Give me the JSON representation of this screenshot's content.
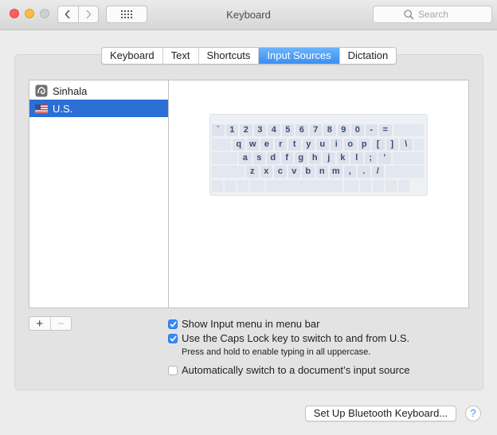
{
  "window": {
    "title": "Keyboard",
    "search_placeholder": "Search"
  },
  "tabs": [
    {
      "label": "Keyboard",
      "active": false
    },
    {
      "label": "Text",
      "active": false
    },
    {
      "label": "Shortcuts",
      "active": false
    },
    {
      "label": "Input Sources",
      "active": true
    },
    {
      "label": "Dictation",
      "active": false
    }
  ],
  "sources": [
    {
      "label": "Sinhala",
      "icon": "sinhala-script-icon",
      "selected": false
    },
    {
      "label": "U.S.",
      "icon": "us-flag-icon",
      "selected": true
    }
  ],
  "keyboard_rows": [
    [
      "`",
      "1",
      "2",
      "3",
      "4",
      "5",
      "6",
      "7",
      "8",
      "9",
      "0",
      "-",
      "="
    ],
    [
      "q",
      "w",
      "e",
      "r",
      "t",
      "y",
      "u",
      "i",
      "o",
      "p",
      "[",
      "]",
      "\\"
    ],
    [
      "a",
      "s",
      "d",
      "f",
      "g",
      "h",
      "j",
      "k",
      "l",
      ";",
      "'"
    ],
    [
      "z",
      "x",
      "c",
      "v",
      "b",
      "n",
      "m",
      ",",
      ".",
      "/"
    ]
  ],
  "controls": {
    "add_label": "+",
    "remove_label": "−"
  },
  "options": {
    "show_input_menu": {
      "label": "Show Input menu in menu bar",
      "checked": true
    },
    "caps_lock_switch": {
      "label": "Use the Caps Lock key to switch to and from U.S.",
      "checked": true
    },
    "caps_lock_note": "Press and hold to enable typing in all uppercase.",
    "auto_switch": {
      "label": "Automatically switch to a document’s input source",
      "checked": false
    }
  },
  "footer": {
    "bluetooth_label": "Set Up Bluetooth Keyboard...",
    "help_label": "?"
  },
  "colors": {
    "accent": "#3a8ff3",
    "selection": "#2b6fd6"
  }
}
